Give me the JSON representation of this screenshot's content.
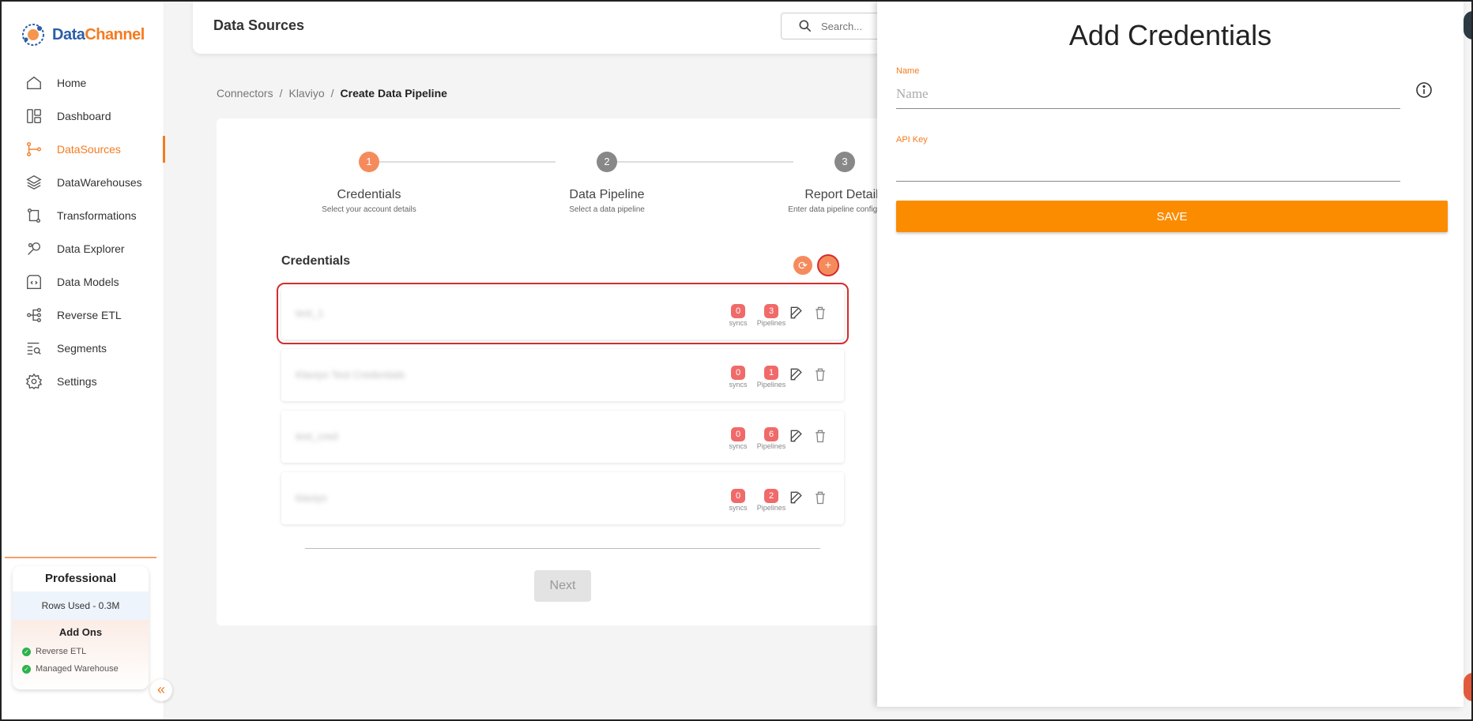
{
  "app": {
    "brand_first": "Data",
    "brand_second": "Channel"
  },
  "sidebar": {
    "items": [
      {
        "label": "Home",
        "icon": "home-icon"
      },
      {
        "label": "Dashboard",
        "icon": "dashboard-icon"
      },
      {
        "label": "DataSources",
        "icon": "datasources-icon",
        "active": true
      },
      {
        "label": "DataWarehouses",
        "icon": "layers-icon"
      },
      {
        "label": "Transformations",
        "icon": "transform-icon"
      },
      {
        "label": "Data Explorer",
        "icon": "explorer-icon"
      },
      {
        "label": "Data Models",
        "icon": "data-models-icon"
      },
      {
        "label": "Reverse ETL",
        "icon": "reverse-etl-icon"
      },
      {
        "label": "Segments",
        "icon": "segments-icon"
      },
      {
        "label": "Settings",
        "icon": "gear-icon"
      }
    ],
    "plan": {
      "name": "Professional",
      "rows_used": "Rows Used - 0.3M",
      "addons_title": "Add Ons",
      "addons": [
        "Reverse ETL",
        "Managed Warehouse"
      ]
    },
    "collapse_glyph": "«"
  },
  "header": {
    "title": "Data Sources",
    "search_placeholder": "Search..."
  },
  "breadcrumb": {
    "items": [
      "Connectors",
      "Klaviyo"
    ],
    "current": "Create Data Pipeline",
    "separator": "/"
  },
  "stepper": {
    "steps": [
      {
        "num": "1",
        "label": "Credentials",
        "sub": "Select your account details",
        "active": true
      },
      {
        "num": "2",
        "label": "Data Pipeline",
        "sub": "Select a data pipeline"
      },
      {
        "num": "3",
        "label": "Report Details",
        "sub": "Enter data pipeline configuration"
      }
    ]
  },
  "credentials": {
    "title": "Credentials",
    "refresh_glyph": "⟳",
    "add_glyph": "+",
    "syncs_label": "syncs",
    "pipelines_label": "Pipelines",
    "rows": [
      {
        "name": "test_1",
        "syncs": "0",
        "pipelines": "3",
        "selected": true
      },
      {
        "name": "Klaviyo Test Credentials",
        "syncs": "0",
        "pipelines": "1"
      },
      {
        "name": "test_cred",
        "syncs": "0",
        "pipelines": "6"
      },
      {
        "name": "klaviyo",
        "syncs": "0",
        "pipelines": "2"
      }
    ]
  },
  "next_label": "Next",
  "panel": {
    "title": "Add Credentials",
    "name_label": "Name",
    "name_placeholder": "Name",
    "name_value": "",
    "api_key_label": "API Key",
    "api_key_value": "",
    "save_label": "SAVE"
  },
  "colors": {
    "accent": "#f47b20",
    "save": "#fb8c00",
    "badge": "#f06a6a",
    "step_active": "#f58b5d",
    "highlight": "#d42d2d"
  }
}
